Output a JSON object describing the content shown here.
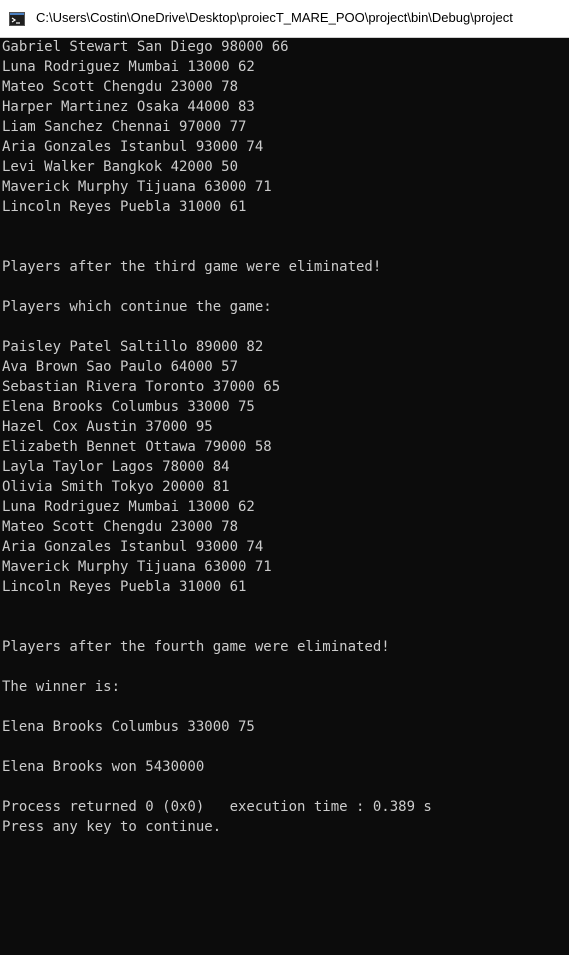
{
  "window": {
    "title": "C:\\Users\\Costin\\OneDrive\\Desktop\\proiecT_MARE_POO\\project\\bin\\Debug\\project",
    "icon": "console-icon"
  },
  "console": {
    "lines": [
      "Gabriel Stewart San Diego 98000 66",
      "Luna Rodriguez Mumbai 13000 62",
      "Mateo Scott Chengdu 23000 78",
      "Harper Martinez Osaka 44000 83",
      "Liam Sanchez Chennai 97000 77",
      "Aria Gonzales Istanbul 93000 74",
      "Levi Walker Bangkok 42000 50",
      "Maverick Murphy Tijuana 63000 71",
      "Lincoln Reyes Puebla 31000 61",
      "",
      "",
      "Players after the third game were eliminated!",
      "",
      "Players which continue the game:",
      "",
      "Paisley Patel Saltillo 89000 82",
      "Ava Brown Sao Paulo 64000 57",
      "Sebastian Rivera Toronto 37000 65",
      "Elena Brooks Columbus 33000 75",
      "Hazel Cox Austin 37000 95",
      "Elizabeth Bennet Ottawa 79000 58",
      "Layla Taylor Lagos 78000 84",
      "Olivia Smith Tokyo 20000 81",
      "Luna Rodriguez Mumbai 13000 62",
      "Mateo Scott Chengdu 23000 78",
      "Aria Gonzales Istanbul 93000 74",
      "Maverick Murphy Tijuana 63000 71",
      "Lincoln Reyes Puebla 31000 61",
      "",
      "",
      "Players after the fourth game were eliminated!",
      "",
      "The winner is:",
      "",
      "Elena Brooks Columbus 33000 75",
      "",
      "Elena Brooks won 5430000",
      "",
      "Process returned 0 (0x0)   execution time : 0.389 s",
      "Press any key to continue."
    ]
  }
}
